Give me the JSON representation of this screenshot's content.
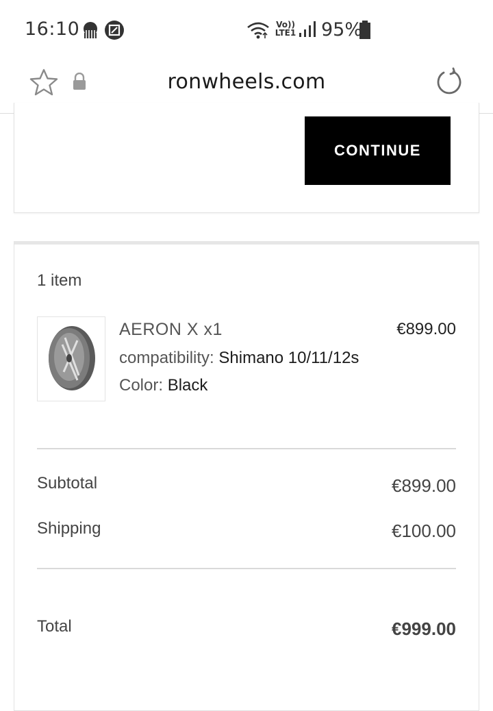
{
  "status_bar": {
    "time": "16:10",
    "battery_percent": "95%",
    "network_label_top": "Vo))",
    "network_label_bottom": "LTE1"
  },
  "browser": {
    "url": "ronwheels.com"
  },
  "checkout": {
    "continue_label": "CONTINUE"
  },
  "summary": {
    "item_count": "1 item",
    "product": {
      "name": "AERON X x1",
      "price": "€899.00",
      "properties": [
        {
          "label": "compatibility:",
          "value": "Shimano 10/11/12s"
        },
        {
          "label": "Color:",
          "value": "Black"
        }
      ]
    },
    "subtotal_label": "Subtotal",
    "subtotal_value": "€899.00",
    "shipping_label": "Shipping",
    "shipping_value": "€100.00",
    "total_label": "Total",
    "total_value": "€999.00"
  }
}
